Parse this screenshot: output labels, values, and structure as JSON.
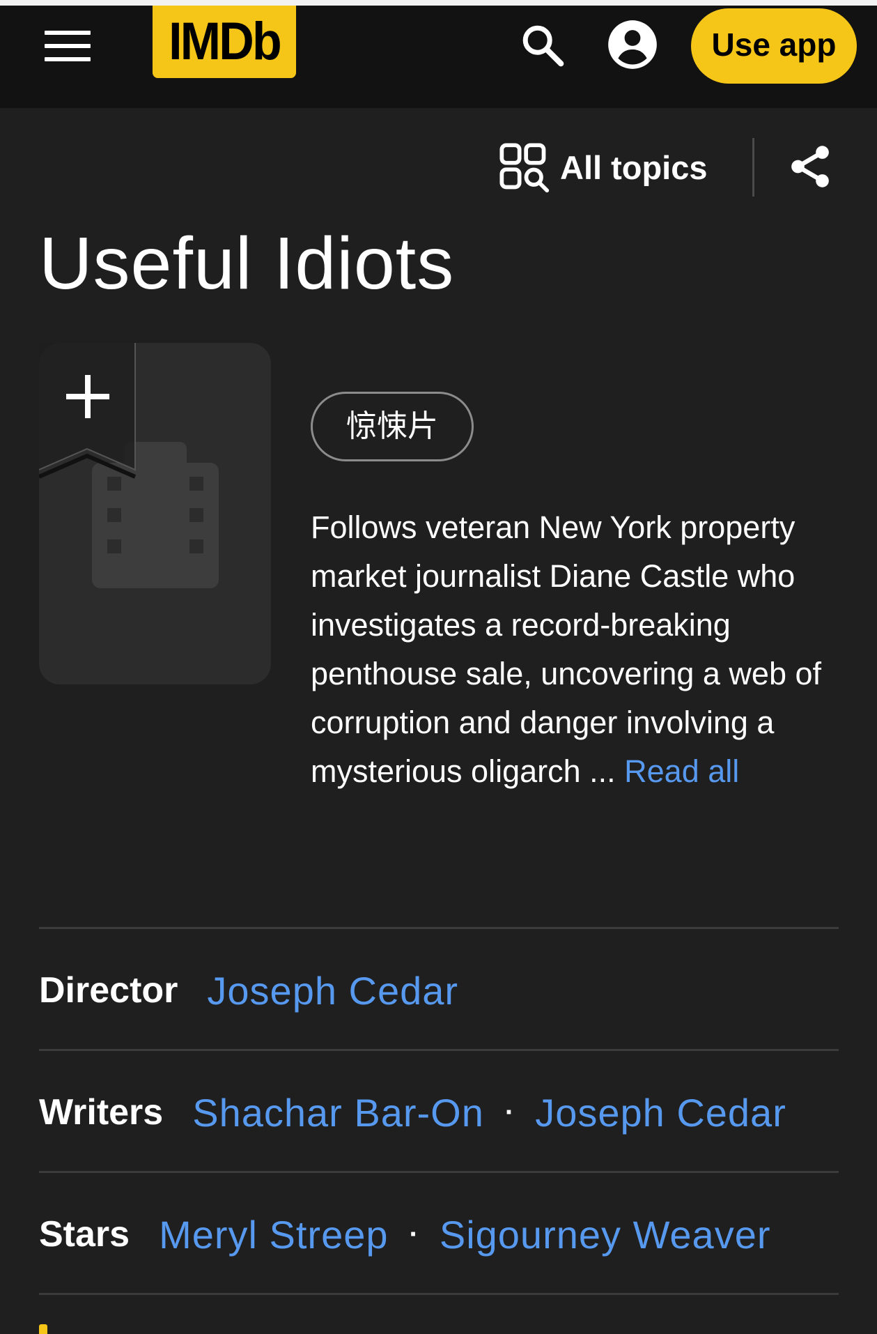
{
  "navbar": {
    "logo_text": "IMDb",
    "use_app_label": "Use app",
    "icons": [
      "menu-icon",
      "search-icon",
      "account-icon"
    ]
  },
  "topics": {
    "label": "All topics",
    "icon": "topics-search-icon"
  },
  "share": {
    "icon": "share-icon"
  },
  "title": "Useful Idiots",
  "poster": {
    "icon": "film-icon",
    "watchlist_icon": "plus-icon"
  },
  "genre": "惊悚片",
  "plot": {
    "text": "Follows veteran New York property market journalist Diane Castle who investigates a record-breaking penthouse sale, uncovering a web of corruption and danger involving a mysterious oligarch ... ",
    "read_all": "Read all"
  },
  "credits": {
    "director": {
      "label": "Director",
      "names": [
        "Joseph Cedar"
      ]
    },
    "writers": {
      "label": "Writers",
      "names": [
        "Shachar Bar-On",
        "Joseph Cedar"
      ]
    },
    "stars": {
      "label": "Stars",
      "names": [
        "Meryl Streep",
        "Sigourney Weaver"
      ]
    },
    "separator": "·"
  },
  "colors": {
    "background": "#1f1f1f",
    "navbar": "#121212",
    "accent": "#f5c518",
    "link": "#5799ef"
  }
}
